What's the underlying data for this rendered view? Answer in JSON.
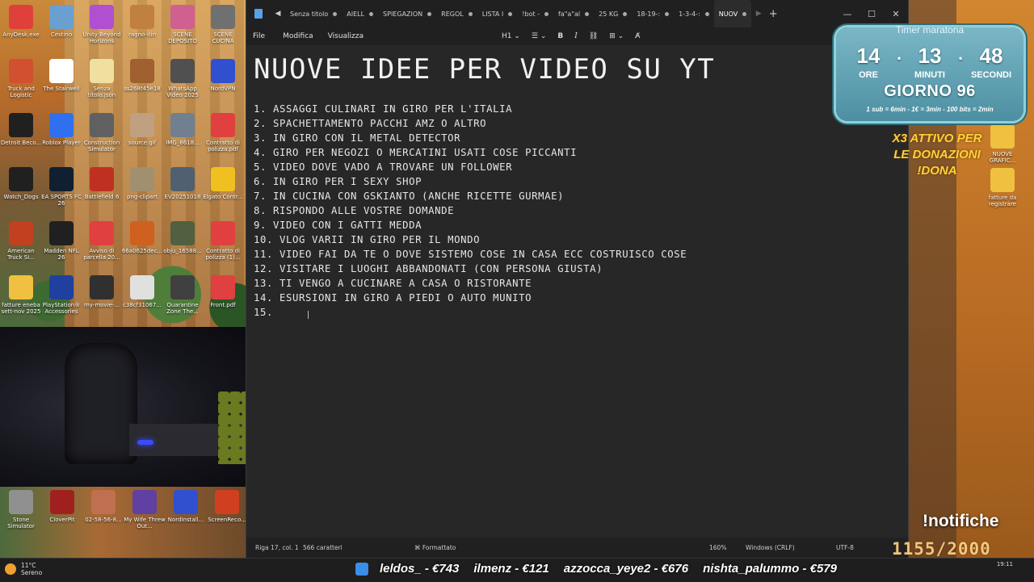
{
  "desktop": {
    "icons": [
      {
        "label": "AnyDesk.exe",
        "color": "#e0403a"
      },
      {
        "label": "Cestino",
        "color": "#6aa0d0"
      },
      {
        "label": "Unity Beyond Horizons",
        "color": "#b050d0"
      },
      {
        "label": "ragno-itin",
        "color": "#c08040"
      },
      {
        "label": "SCENE DEPOSITO",
        "color": "#d06090"
      },
      {
        "label": "SCENE CUCINA",
        "color": "#707070"
      },
      {
        "label": "Truck and Logistic",
        "color": "#d05030"
      },
      {
        "label": "The Stairwell",
        "color": "#ffffff"
      },
      {
        "label": "Senza titolo.json",
        "color": "#f0e0a0"
      },
      {
        "label": "ss268t45e18",
        "color": "#a06030"
      },
      {
        "label": "WhatsApp Video 2025",
        "color": "#505050"
      },
      {
        "label": "NordVPN",
        "color": "#3050d0"
      },
      {
        "label": "Detroit Beco...",
        "color": "#202020"
      },
      {
        "label": "Roblox Player",
        "color": "#3070f0"
      },
      {
        "label": "Construction Simulator",
        "color": "#606060"
      },
      {
        "label": "source.gif",
        "color": "#c0a080"
      },
      {
        "label": "IMG_8618...",
        "color": "#708090"
      },
      {
        "label": "Contratto di polizza.pdf",
        "color": "#e04040"
      },
      {
        "label": "Watch_Dogs",
        "color": "#202020"
      },
      {
        "label": "EA SPORTS FC 26",
        "color": "#102030"
      },
      {
        "label": "Battlefield 6",
        "color": "#c03020"
      },
      {
        "label": "png-clipart",
        "color": "#a09070"
      },
      {
        "label": "EV20251018",
        "color": "#506070"
      },
      {
        "label": "Elgato Contr...",
        "color": "#f0c020"
      },
      {
        "label": "American Truck Si...",
        "color": "#c04020"
      },
      {
        "label": "Madden NFL 26",
        "color": "#202020"
      },
      {
        "label": "Avviso di parcella 20...",
        "color": "#e04040"
      },
      {
        "label": "66a0625dec...",
        "color": "#d06020"
      },
      {
        "label": "obju_16588...",
        "color": "#506040"
      },
      {
        "label": "Contratto di polizza (1)...",
        "color": "#e04040"
      },
      {
        "label": "fatture eneba sett-nov 2025",
        "color": "#f0c040"
      },
      {
        "label": "PlayStation® Accessories",
        "color": "#2040a0"
      },
      {
        "label": "my-movie-...",
        "color": "#303030"
      },
      {
        "label": "c38cf31067...",
        "color": "#e0e0e0"
      },
      {
        "label": "Quarantine Zone The...",
        "color": "#404040"
      },
      {
        "label": "Front.pdf",
        "color": "#e04040"
      }
    ],
    "bottom_icons": [
      {
        "label": "Stone Simulator",
        "color": "#909090"
      },
      {
        "label": "CloverPit",
        "color": "#a02020"
      },
      {
        "label": "02-58-56-8...",
        "color": "#c07050"
      },
      {
        "label": "My Wife Threw Out...",
        "color": "#6040a0"
      },
      {
        "label": "NordInstall...",
        "color": "#3050d0"
      },
      {
        "label": "ScreenReco...",
        "color": "#d04020"
      }
    ]
  },
  "notepad": {
    "tabs": [
      {
        "label": "Senza titolo",
        "active": false
      },
      {
        "label": "AIELL",
        "active": false
      },
      {
        "label": "SPIEGAZION",
        "active": false
      },
      {
        "label": "REGOL",
        "active": false
      },
      {
        "label": "LISTA I",
        "active": false
      },
      {
        "label": "!bot -",
        "active": false
      },
      {
        "label": "fa\"a\"al",
        "active": false
      },
      {
        "label": "25 KG",
        "active": false
      },
      {
        "label": "18-19-:",
        "active": false
      },
      {
        "label": "1-3-4-:",
        "active": false
      },
      {
        "label": "NUOV",
        "active": true
      }
    ],
    "new_tab_icon": "plus-icon",
    "window_controls": {
      "minimize": "—",
      "maximize": "☐",
      "close": "✕"
    },
    "menu": {
      "file": "File",
      "edit": "Modifica",
      "view": "Visualizza"
    },
    "toolbar": {
      "heading": "H1",
      "list_icon": "list-icon",
      "bold": "B",
      "italic": "I",
      "link_icon": "link-icon",
      "table_icon": "table-icon",
      "clear_icon": "clear-format-icon"
    },
    "title": "NUOVE IDEE PER VIDEO SU YT",
    "items": [
      "1. ASSAGGI CULINARI IN GIRO PER L'ITALIA",
      "2. SPACHETTAMENTO PACCHI AMZ O ALTRO",
      "3. IN GIRO CON IL METAL DETECTOR",
      "4. GIRO PER NEGOZI O MERCATINI USATI COSE PICCANTI",
      "5. VIDEO DOVE VADO A TROVARE UN FOLLOWER",
      "6. IN GIRO PER I SEXY SHOP",
      "7. IN CUCINA CON GSKIANTO (ANCHE RICETTE GURMAE)",
      "8. RISPONDO ALLE VOSTRE DOMANDE",
      "9. VIDEO CON I GATTI MEDDA",
      "10. VLOG VARII IN GIRO PER IL MONDO",
      "11. VIDEO FAI DA TE O DOVE SISTEMO COSE IN CASA ECC COSTRUISCO COSE",
      "12. VISITARE I LUOGHI ABBANDONATI (CON PERSONA GIUSTA)",
      "13. TI VENGO A CUCINARE A CASA O RISTORANTE",
      "14. ESURSIONI IN GIRO A PIEDI O AUTO MUNITO",
      "15."
    ],
    "status": {
      "position": "Riga 17, col. 1",
      "chars": "566 caratteri",
      "format": "Formattato",
      "zoom": "160%",
      "line_ending": "Windows (CRLF)",
      "encoding": "UTF-8"
    }
  },
  "overlay": {
    "timer_title": "Timer maratona",
    "hours": "14",
    "minutes": "13",
    "seconds": "48",
    "hours_label": "ORE",
    "minutes_label": "MINUTI",
    "seconds_label": "SECONDI",
    "day": "GIORNO 96",
    "rules": "1 sub = 6min - 1€ = 3min - 100 bits = 2min",
    "donation_lines": [
      "X3 ATTIVO PER",
      "LE DONAZIONI",
      "!DONA"
    ],
    "right_desktop": [
      {
        "label": "NUOVE GRAFIC...",
        "color": "#f0c040"
      },
      {
        "label": "fatture da registrare",
        "color": "#f0c040"
      }
    ],
    "notifiche": "!notifiche",
    "goal": "1155/2000"
  },
  "taskbar": {
    "temperature": "11°C",
    "weather": "Sereno",
    "ticker": [
      "leldos_ - €743",
      "ilmenz - €121",
      "azzocca_yeye2 - €676",
      "nishta_palummo - €579"
    ],
    "time": "19:11"
  },
  "colors": {
    "accent": "#5aa0e8",
    "timer_bg": "#4d8fa2",
    "donation": "#ffd23a"
  }
}
